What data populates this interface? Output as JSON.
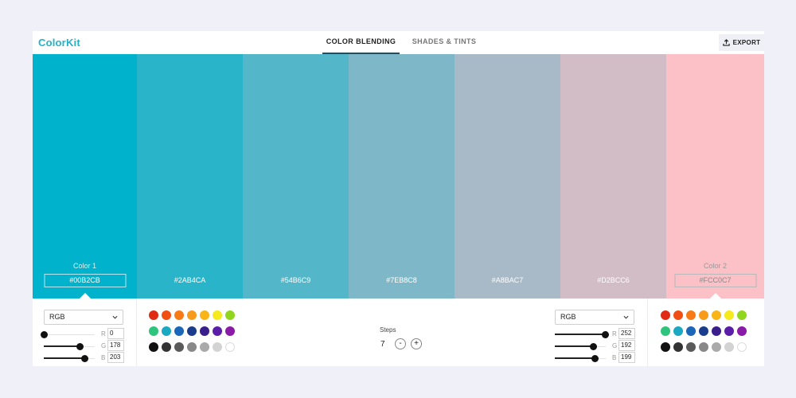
{
  "app": {
    "logo": "ColorKit"
  },
  "tabs": [
    {
      "label": "COLOR BLENDING",
      "active": true
    },
    {
      "label": "SHADES & TINTS",
      "active": false
    }
  ],
  "header": {
    "export_label": "EXPORT",
    "export_icon": "upload-icon"
  },
  "swatches": [
    {
      "hex": "#00B2CB",
      "label": "Color 1",
      "color": "#00b2cb",
      "boxed": true,
      "dark": false,
      "pointer": true,
      "width": 131
    },
    {
      "hex": "#2AB4CA",
      "label": "",
      "color": "#2ab4ca",
      "boxed": false,
      "dark": false,
      "pointer": false,
      "width": 133
    },
    {
      "hex": "#54B6C9",
      "label": "",
      "color": "#54b6c9",
      "boxed": false,
      "dark": false,
      "pointer": false,
      "width": 133
    },
    {
      "hex": "#7EB8C8",
      "label": "",
      "color": "#7eb8c8",
      "boxed": false,
      "dark": false,
      "pointer": false,
      "width": 133
    },
    {
      "hex": "#A8BAC7",
      "label": "",
      "color": "#a8bac7",
      "boxed": false,
      "dark": false,
      "pointer": false,
      "width": 133
    },
    {
      "hex": "#D2BCC6",
      "label": "",
      "color": "#d2bcc6",
      "boxed": false,
      "dark": false,
      "pointer": false,
      "width": 133
    },
    {
      "hex": "#FCC0C7",
      "label": "Color 2",
      "color": "#fcc0c7",
      "boxed": true,
      "dark": true,
      "pointer": true,
      "width": 123
    }
  ],
  "left_picker": {
    "mode": "RGB",
    "channels": [
      {
        "letter": "R",
        "value": "0",
        "fraction": 0.0
      },
      {
        "letter": "G",
        "value": "178",
        "fraction": 0.698
      },
      {
        "letter": "B",
        "value": "203",
        "fraction": 0.796
      }
    ]
  },
  "right_picker": {
    "mode": "RGB",
    "channels": [
      {
        "letter": "R",
        "value": "252",
        "fraction": 0.988
      },
      {
        "letter": "G",
        "value": "192",
        "fraction": 0.753
      },
      {
        "letter": "B",
        "value": "199",
        "fraction": 0.78
      }
    ]
  },
  "palette_colors": [
    [
      "#e02a14",
      "#f04e14",
      "#f77a16",
      "#f99b1a",
      "#f9b418",
      "#f4ea1c",
      "#8fd61c"
    ],
    [
      "#2ec47e",
      "#1aa8c2",
      "#1a66b8",
      "#1a3c8c",
      "#3a1e8c",
      "#5a1ea8",
      "#8a1aa8"
    ],
    [
      "#111111",
      "#333333",
      "#5a5a5a",
      "#888888",
      "#aaaaaa",
      "#d3d3d3",
      "#ffffff"
    ]
  ],
  "steps": {
    "label": "Steps",
    "value": "7",
    "minus": "-",
    "plus": "+"
  }
}
